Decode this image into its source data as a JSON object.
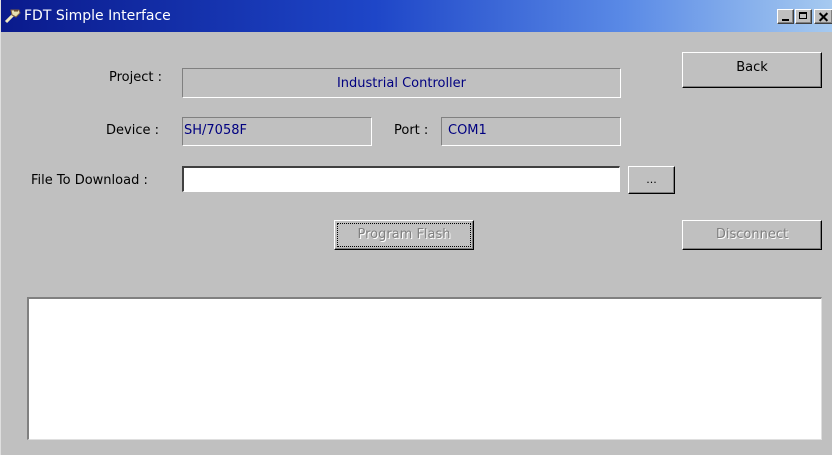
{
  "window": {
    "title": "FDT Simple Interface",
    "titlebar_colors": [
      "#0a1a8c",
      "#a6caf0"
    ],
    "title_icon": "fdt-app-icon"
  },
  "project": {
    "label": "Project :",
    "value": "Industrial Controller"
  },
  "device": {
    "label": "Device :",
    "value": "SH/7058F"
  },
  "port": {
    "label": "Port :",
    "value": "COM1"
  },
  "file": {
    "label": "File To Download :",
    "value": "",
    "browse_label": "..."
  },
  "buttons": {
    "back": "Back",
    "program_flash": "Program Flash",
    "disconnect": "Disconnect"
  },
  "output_log": {
    "text": ""
  },
  "colors": {
    "face": "#c0c0c0",
    "value_text": "#000080",
    "disabled_text": "#808080"
  }
}
